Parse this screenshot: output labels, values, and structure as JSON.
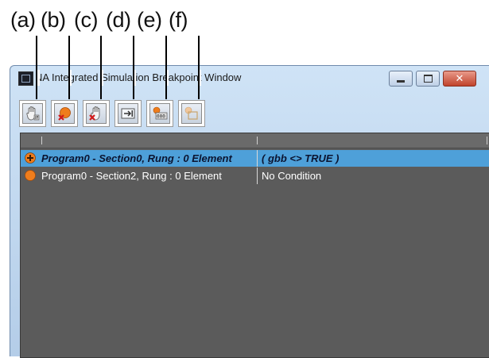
{
  "callouts": [
    "(a)",
    "(b)",
    "(c)",
    "(d)",
    "(e)",
    "(f)"
  ],
  "window": {
    "title": "NA Integrated Simulation Breakpoint Window",
    "accent_color": "#4ea0d9",
    "close_color": "#c0432c"
  },
  "toolbar": {
    "buttons": [
      {
        "icon": "hand-stop-icon"
      },
      {
        "icon": "breakpoint-delete-icon"
      },
      {
        "icon": "hand-delete-icon"
      },
      {
        "icon": "go-to-icon"
      },
      {
        "icon": "breakpoint-counter-icon"
      },
      {
        "icon": "breakpoint-disabled-icon"
      }
    ]
  },
  "breakpoints": {
    "rows": [
      {
        "name": "Program0 - Section0, Rung : 0  Element",
        "condition": "( gbb <> TRUE )",
        "selected": true
      },
      {
        "name": "Program0 - Section2, Rung : 0  Element",
        "condition": "No Condition",
        "selected": false
      }
    ]
  }
}
